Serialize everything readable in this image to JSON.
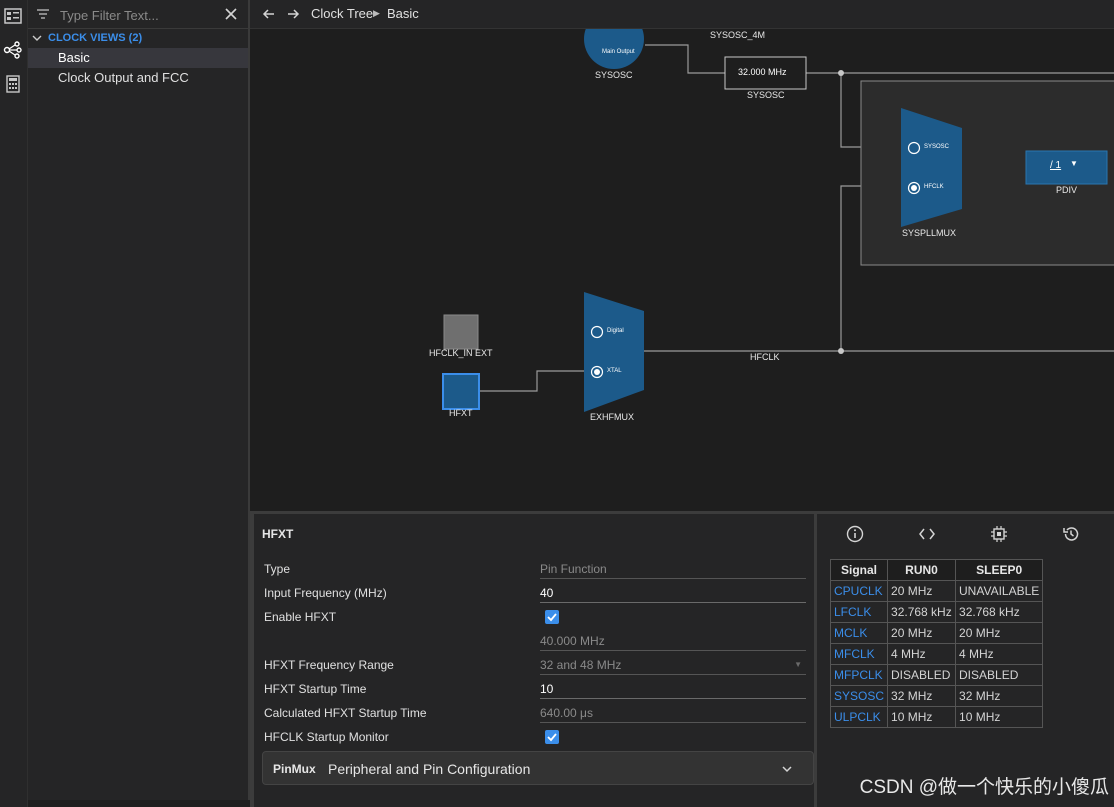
{
  "sidebar": {
    "filter_placeholder": "Type Filter Text...",
    "group_label": "CLOCK VIEWS (2)",
    "items": [
      {
        "label": "Basic"
      },
      {
        "label": "Clock Output and FCC"
      }
    ]
  },
  "header": {
    "breadcrumb": [
      "Clock Tree",
      "Basic"
    ]
  },
  "diagram": {
    "sysosc_label": "SYSOSC",
    "sysosc_inner_text": "Main Output",
    "sysosc_4m_label": "SYSOSC_4M",
    "sysosc_freq_value": "32.000 MHz",
    "sysosc_freq_label": "SYSOSC",
    "syspllmux": {
      "label": "SYSPLLMUX",
      "input1": "SYSOSC",
      "input2": "HFCLK"
    },
    "pdiv": {
      "label": "PDIV",
      "value": "/ 1"
    },
    "hfclk_in_ext_label": "HFCLK_IN EXT",
    "hfxt_label": "HFXT",
    "exhfmux": {
      "label": "EXHFMUX",
      "input1": "Digital",
      "input2": "XTAL"
    },
    "hfclk_label": "HFCLK"
  },
  "hfxt_panel": {
    "title": "HFXT",
    "type_label": "Type",
    "type_value": "Pin Function",
    "input_freq_label": "Input Frequency (MHz)",
    "input_freq_value": "40",
    "enable_label": "Enable HFXT",
    "enable_checked": true,
    "computed_freq": "40.000 MHz",
    "range_label": "HFXT Frequency Range",
    "range_value": "32 and 48 MHz",
    "startup_label": "HFXT Startup Time",
    "startup_value": "10",
    "calc_startup_label": "Calculated HFXT Startup Time",
    "calc_startup_value": "640.00 μs",
    "monitor_label": "HFCLK Startup Monitor",
    "monitor_checked": true,
    "pinmux_tag": "PinMux",
    "pinmux_label": "Peripheral and Pin Configuration"
  },
  "signal_table": {
    "headers": [
      "Signal",
      "RUN0",
      "SLEEP0"
    ],
    "rows": [
      [
        "CPUCLK",
        "20 MHz",
        "UNAVAILABLE"
      ],
      [
        "LFCLK",
        "32.768 kHz",
        "32.768 kHz"
      ],
      [
        "MCLK",
        "20 MHz",
        "20 MHz"
      ],
      [
        "MFCLK",
        "4 MHz",
        "4 MHz"
      ],
      [
        "MFPCLK",
        "DISABLED",
        "DISABLED"
      ],
      [
        "SYSOSC",
        "32 MHz",
        "32 MHz"
      ],
      [
        "ULPCLK",
        "10 MHz",
        "10 MHz"
      ]
    ]
  },
  "watermark": "CSDN @做一个快乐的小傻瓜",
  "colors": {
    "accent": "#3b8eea",
    "block": "#1c5a8a",
    "background": "#1e1e1e"
  }
}
